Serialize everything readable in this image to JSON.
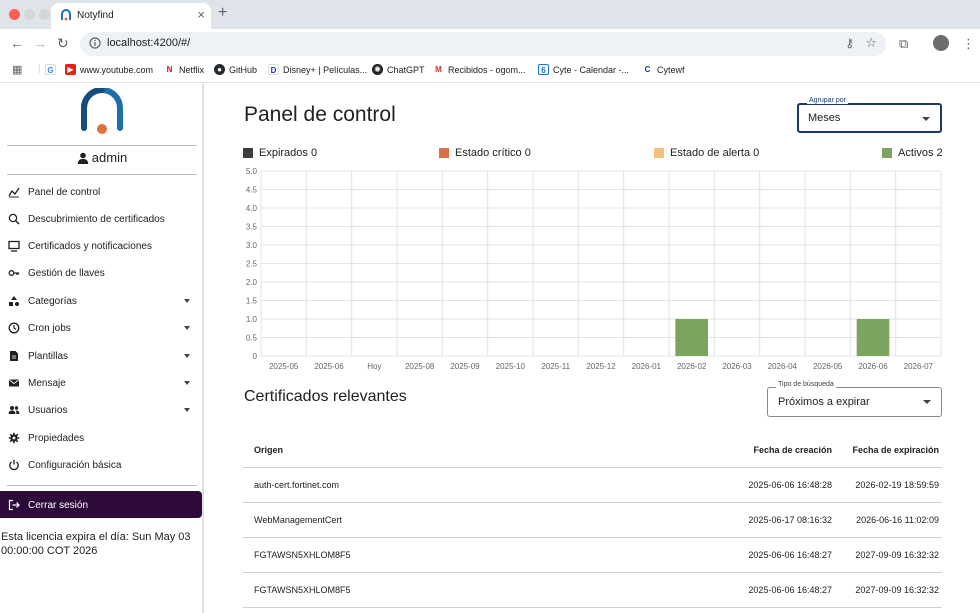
{
  "browser": {
    "tab_title": "Notyfind",
    "url": "localhost:4200/#/",
    "bookmarks": [
      {
        "label": "",
        "icon": "google-icon"
      },
      {
        "label": "www.youtube.com",
        "icon": "youtube-icon"
      },
      {
        "label": "Netflix",
        "icon": "netflix-icon"
      },
      {
        "label": "GitHub",
        "icon": "github-icon"
      },
      {
        "label": "Disney+ | Películas...",
        "icon": "disney-icon"
      },
      {
        "label": "ChatGPT",
        "icon": "chatgpt-icon"
      },
      {
        "label": "Recibidos - ogom...",
        "icon": "gmail-icon"
      },
      {
        "label": "Cyte - Calendar -...",
        "icon": "calendar-icon"
      },
      {
        "label": "Cytewf",
        "icon": "cytewf-icon"
      }
    ]
  },
  "sidebar": {
    "user": "admin",
    "menu": [
      {
        "label": "Panel de control",
        "icon": "dashboard-icon",
        "expandable": false
      },
      {
        "label": "Descubrimiento de certificados",
        "icon": "discover-icon",
        "expandable": false
      },
      {
        "label": "Certificados y notificaciones",
        "icon": "monitor-icon",
        "expandable": false
      },
      {
        "label": "Gestión de llaves",
        "icon": "key-icon",
        "expandable": false
      },
      {
        "label": "Categorías",
        "icon": "categories-icon",
        "expandable": true
      },
      {
        "label": "Cron jobs",
        "icon": "clock-icon",
        "expandable": true
      },
      {
        "label": "Plantillas",
        "icon": "document-icon",
        "expandable": true
      },
      {
        "label": "Mensaje",
        "icon": "mail-icon",
        "expandable": true
      },
      {
        "label": "Usuarios",
        "icon": "users-icon",
        "expandable": true
      },
      {
        "label": "Propiedades",
        "icon": "gear-icon",
        "expandable": false
      },
      {
        "label": "Configuración básica",
        "icon": "power-icon",
        "expandable": false
      }
    ],
    "logout_label": "Cerrar sesión",
    "license_text": "Esta licencia expira el día: Sun May 03 00:00:00 COT 2026"
  },
  "main": {
    "title": "Panel de control",
    "group_by": {
      "label": "Agrupar por",
      "value": "Meses"
    },
    "legend": [
      {
        "label": "Expirados 0",
        "color": "#3d3d3d"
      },
      {
        "label": "Estado crítico 0",
        "color": "#d9714a"
      },
      {
        "label": "Estado de alerta 0",
        "color": "#f2c27b"
      },
      {
        "label": "Activos 2",
        "color": "#7ba55f"
      }
    ],
    "section_title": "Certificados relevantes",
    "search_type": {
      "label": "Tipo de búsqueda",
      "value": "Próximos a expirar"
    },
    "table": {
      "headers": [
        "Origen",
        "Fecha de creación",
        "Fecha de expiración"
      ],
      "rows": [
        [
          "auth-cert.fortinet.com",
          "2025-06-06 16:48:28",
          "2026-02-19 18:59:59"
        ],
        [
          "WebManagementCert",
          "2025-06-17 08:16:32",
          "2026-06-16 11:02:09"
        ],
        [
          "FGTAWSN5XHLOM8F5",
          "2025-06-06 16:48:27",
          "2027-09-09 16:32:32"
        ],
        [
          "FGTAWSN5XHLOM8F5",
          "2025-06-06 16:48:27",
          "2027-09-09 16:32:32"
        ]
      ]
    }
  },
  "chart_data": {
    "type": "bar",
    "categories": [
      "2025-05",
      "2025-06",
      "Hoy",
      "2025-08",
      "2025-09",
      "2025-10",
      "2025-11",
      "2025-12",
      "2026-01",
      "2026-02",
      "2026-03",
      "2026-04",
      "2026-05",
      "2026-06",
      "2026-07"
    ],
    "series": [
      {
        "name": "Expirados",
        "color": "#3d3d3d",
        "values": [
          0,
          0,
          0,
          0,
          0,
          0,
          0,
          0,
          0,
          0,
          0,
          0,
          0,
          0,
          0
        ]
      },
      {
        "name": "Estado crítico",
        "color": "#d9714a",
        "values": [
          0,
          0,
          0,
          0,
          0,
          0,
          0,
          0,
          0,
          0,
          0,
          0,
          0,
          0,
          0
        ]
      },
      {
        "name": "Estado de alerta",
        "color": "#f2c27b",
        "values": [
          0,
          0,
          0,
          0,
          0,
          0,
          0,
          0,
          0,
          0,
          0,
          0,
          0,
          0,
          0
        ]
      },
      {
        "name": "Activos",
        "color": "#7ba55f",
        "values": [
          0,
          0,
          0,
          0,
          0,
          0,
          0,
          0,
          0,
          1,
          0,
          0,
          0,
          1,
          0
        ]
      }
    ],
    "yticks": [
      "0",
      "0.5",
      "1.0",
      "1.5",
      "2.0",
      "2.5",
      "3.0",
      "3.5",
      "4.0",
      "4.5",
      "5.0"
    ],
    "ylim": [
      0,
      5
    ],
    "grid": true
  }
}
